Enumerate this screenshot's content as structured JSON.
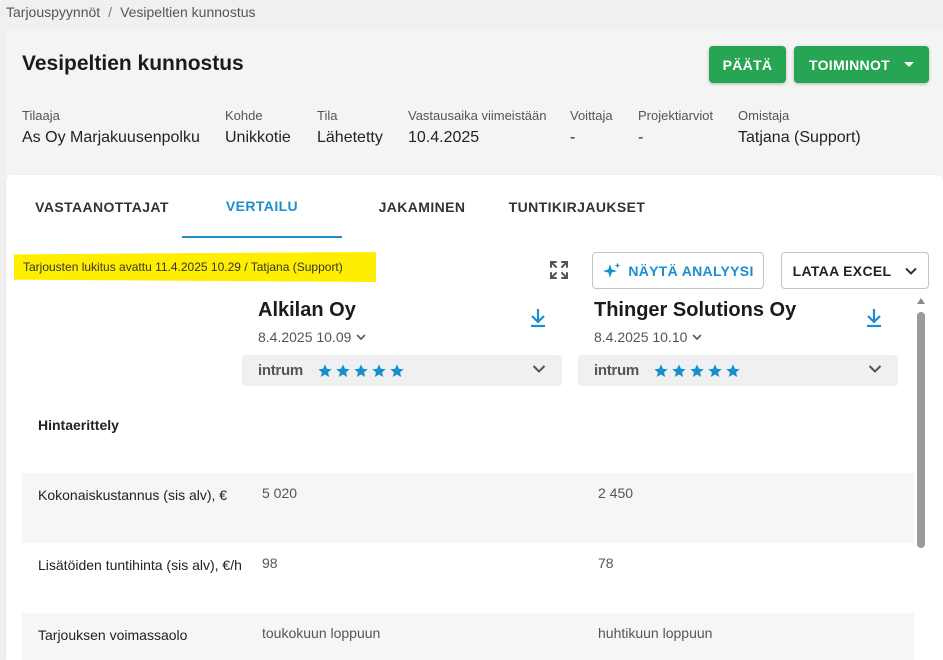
{
  "breadcrumb": {
    "parent": "Tarjouspyynnöt",
    "separator": "/",
    "current": "Vesipeltien kunnostus"
  },
  "header": {
    "title": "Vesipeltien kunnostus",
    "paata_label": "PÄÄTÄ",
    "toiminnot_label": "TOIMINNOT",
    "meta": [
      {
        "label": "Tilaaja",
        "value": "As Oy Marjakuusenpolku"
      },
      {
        "label": "Kohde",
        "value": "Unikkotie"
      },
      {
        "label": "Tila",
        "value": "Lähetetty"
      },
      {
        "label": "Vastausaika viimeistään",
        "value": "10.4.2025"
      },
      {
        "label": "Voittaja",
        "value": "-"
      },
      {
        "label": "Projektiarviot",
        "value": "-"
      },
      {
        "label": "Omistaja",
        "value": "Tatjana (Support)"
      }
    ]
  },
  "tabs": [
    {
      "label": "VASTAANOTTAJAT"
    },
    {
      "label": "VERTAILU"
    },
    {
      "label": "JAKAMINEN"
    },
    {
      "label": "TUNTIKIRJAUKSET"
    }
  ],
  "comparison": {
    "lock_note": "Tarjousten lukitus avattu 11.4.2025 10.29 / Tatjana (Support)",
    "analysis_label": "NÄYTÄ ANALYYSI",
    "excel_label": "LATAA EXCEL",
    "credit_provider": "intrum",
    "star_color": "#1a8fcf",
    "accent_color": "#1a8fcf",
    "action_color": "#27a552",
    "suppliers": [
      {
        "name": "Alkilan Oy",
        "date": "8.4.2025 10.09",
        "rating": 5
      },
      {
        "name": "Thinger Solutions Oy",
        "date": "8.4.2025 10.10",
        "rating": 5
      }
    ],
    "section_title": "Hintaerittely",
    "rows": [
      {
        "label": "Kokonaiskustannus (sis alv), €",
        "values": [
          "5 020",
          "2 450"
        ]
      },
      {
        "label": "Lisätöiden tuntihinta (sis alv), €/h",
        "values": [
          "98",
          "78"
        ]
      },
      {
        "label": "Tarjouksen voimassaolo",
        "values": [
          "toukokuun loppuun",
          "huhtikuun loppuun"
        ]
      }
    ]
  }
}
